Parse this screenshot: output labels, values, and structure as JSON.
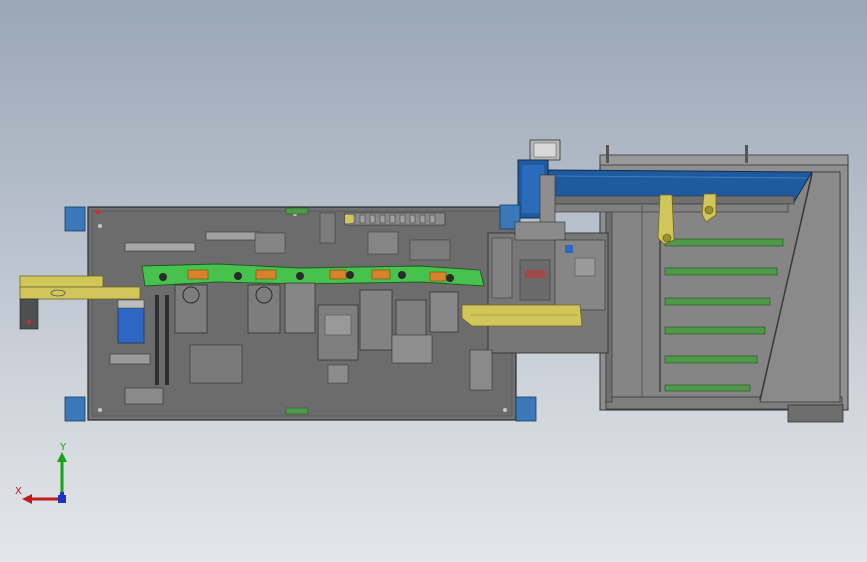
{
  "viewport": {
    "background_top": "#9aa7b8",
    "background_bottom": "#e3e6ea"
  },
  "model": {
    "colors": {
      "plate": "#707070",
      "plate_dark": "#4f4f4f",
      "steel": "#9c9c9c",
      "track_yellow": "#d0c65a",
      "fixture_green": "#47c24c",
      "bushing_orange": "#d9822b",
      "conveyor_blue": "#1f5a9e",
      "motor_blue": "#2f66c4",
      "belt_green": "#4f9a48",
      "foot_blue": "#3a78b8",
      "frame_grey": "#8c8c8c"
    }
  },
  "triad": {
    "x_label": "X",
    "y_label": "Y",
    "x_color": "#c11c1c",
    "y_color": "#16a316",
    "z_color": "#1c34c1"
  }
}
